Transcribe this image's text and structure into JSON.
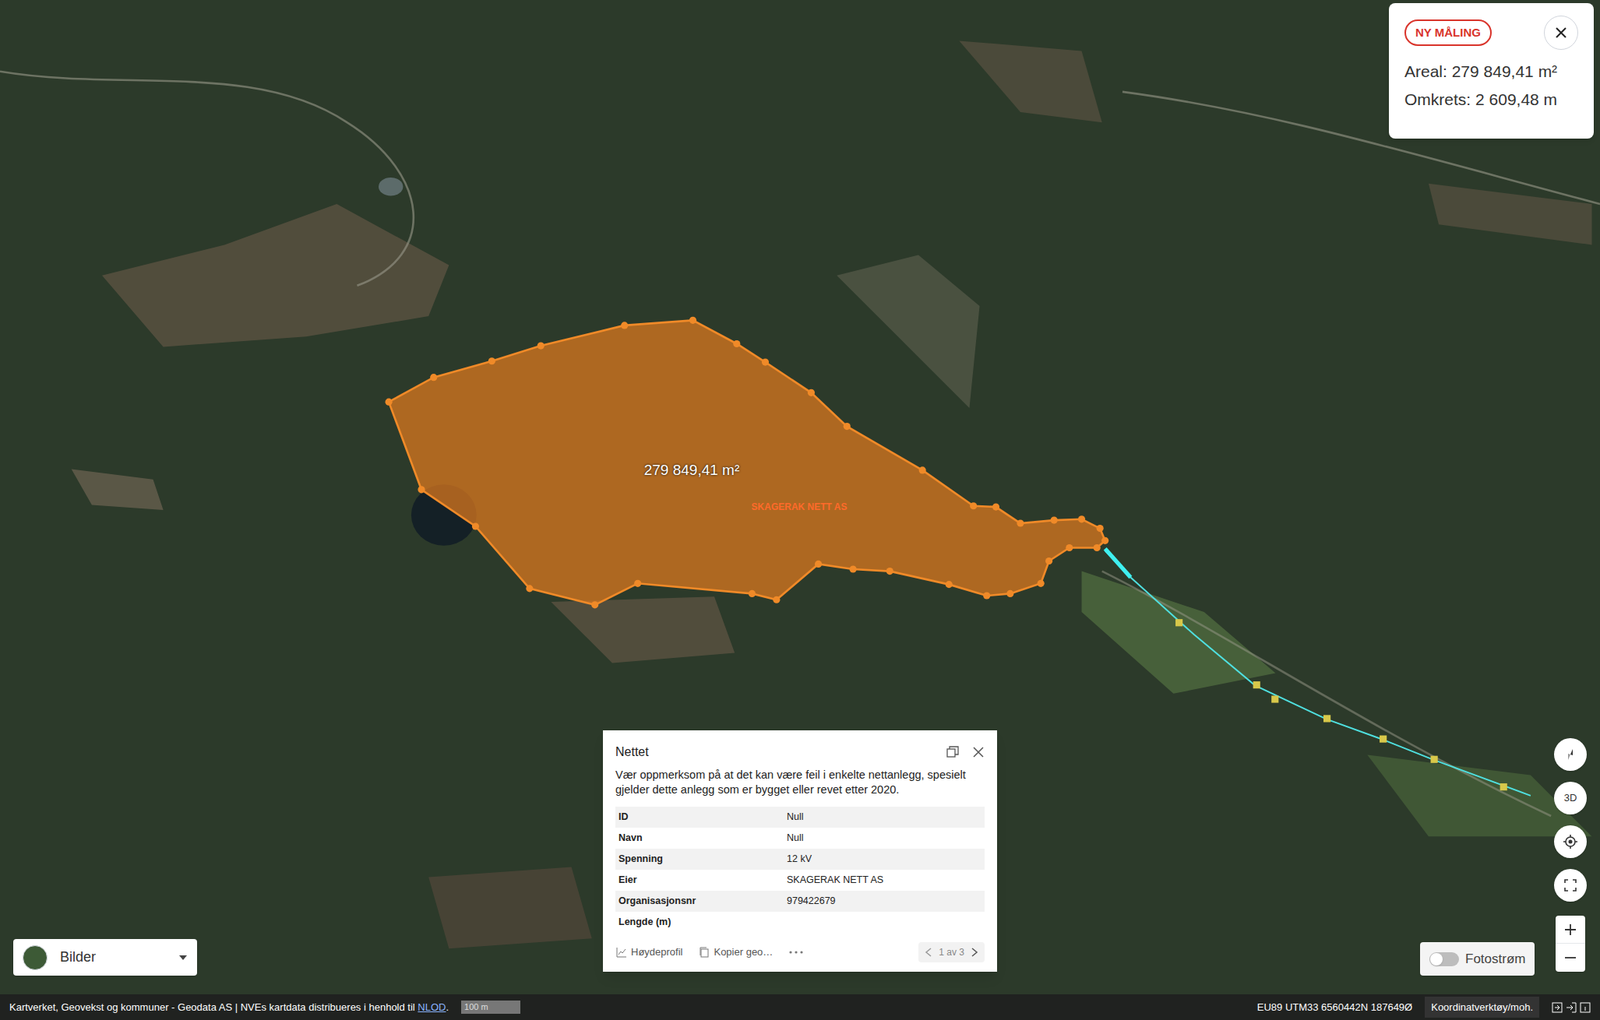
{
  "measurement": {
    "new_button": "NY MÅLING",
    "area": "Areal: 279 849,41 m²",
    "perimeter": "Omkrets: 2 609,48 m"
  },
  "map": {
    "polygon_label": "279 849,41 m²",
    "owner_label": "SKAGERAK NETT AS"
  },
  "info_panel": {
    "title": "Nettet",
    "warning": "Vær oppmerksom på at det kan være feil i enkelte nettanlegg, spesielt gjelder dette anlegg som er bygget eller revet etter 2020.",
    "rows": [
      {
        "label": "ID",
        "value": "Null"
      },
      {
        "label": "Navn",
        "value": "Null"
      },
      {
        "label": "Spenning",
        "value": "12 kV"
      },
      {
        "label": "Eier",
        "value": "SKAGERAK NETT AS"
      },
      {
        "label": "Organisasjonsnr",
        "value": "979422679"
      },
      {
        "label": "Lengde (m)",
        "value": ""
      }
    ],
    "footer": {
      "elevation": "Høydeprofil",
      "copy": "Kopier geo…",
      "pager": "1 av 3"
    }
  },
  "layer_select": {
    "label": "Bilder"
  },
  "controls": {
    "three_d": "3D"
  },
  "photo_stream": {
    "label": "Fotostrøm",
    "on": false
  },
  "status_bar": {
    "attribution": "Kartverket, Geovekst og kommuner - Geodata AS | NVEs kartdata distribueres i henhold til ",
    "link": "NLOD",
    "attribution_end": ".",
    "scale": "100 m",
    "coords": "EU89 UTM33 6560442N 187649Ø",
    "tool": "Koordinatverktøy/moh."
  }
}
